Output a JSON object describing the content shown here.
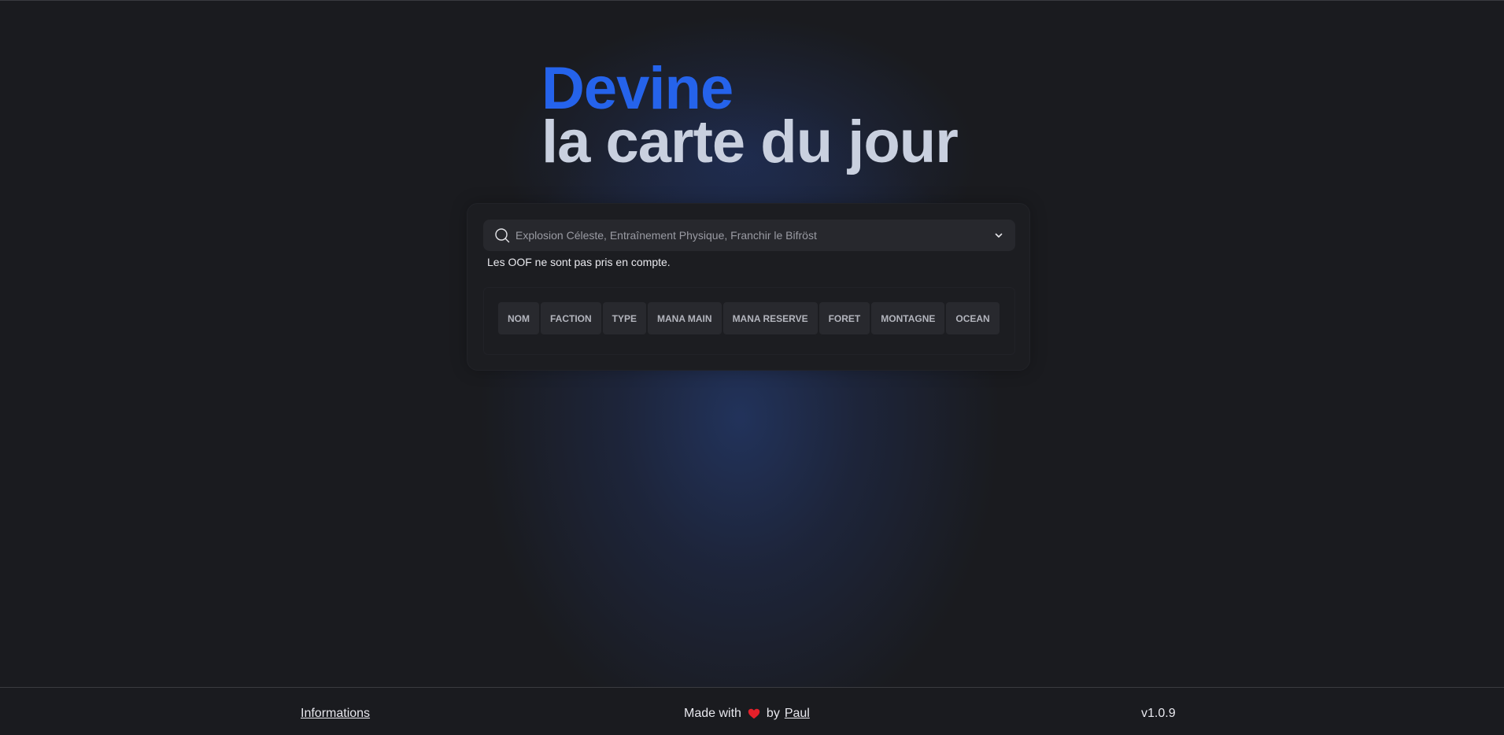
{
  "hero": {
    "accent": "Devine",
    "title": "la carte du jour"
  },
  "search": {
    "placeholder": "Explosion Céleste, Entraînement Physique, Franchir le Bifröst",
    "value": "",
    "icon": "search-icon",
    "dropdown_icon": "chevron-down-icon"
  },
  "note": "Les OOF ne sont pas pris en compte.",
  "table": {
    "columns": [
      "NOM",
      "FACTION",
      "TYPE",
      "MANA MAIN",
      "MANA RESERVE",
      "FORET",
      "MONTAGNE",
      "OCEAN"
    ],
    "rows": []
  },
  "footer": {
    "info_link": "Informations",
    "made_prefix": "Made with",
    "made_by": "by",
    "author": "Paul",
    "version": "v1.0.9",
    "heart_icon": "heart-icon"
  },
  "colors": {
    "accent": "#2563eb",
    "title": "#c9d0df",
    "background": "#1a1b1f",
    "heart": "#e5202a"
  }
}
